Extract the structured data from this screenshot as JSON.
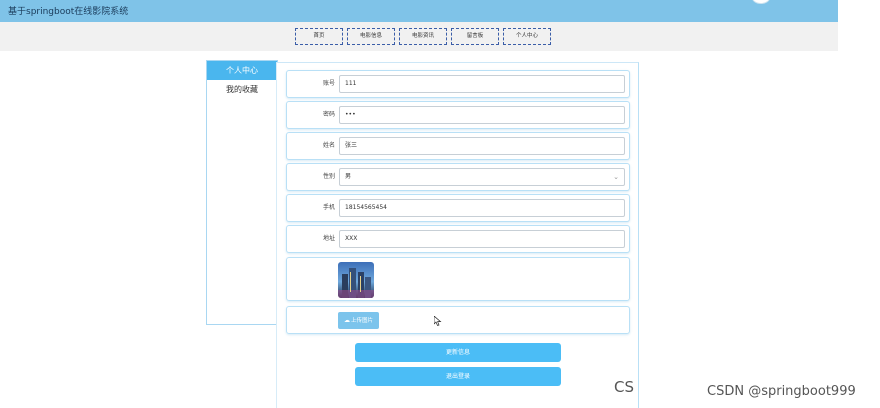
{
  "app": {
    "title": "基于springboot在线影院系统"
  },
  "nav": {
    "items": [
      "首页",
      "电影信息",
      "电影资讯",
      "留言板",
      "个人中心"
    ]
  },
  "sidebar": {
    "items": [
      "个人中心",
      "我的收藏"
    ],
    "active_index": 0
  },
  "form": {
    "account": {
      "label": "账号",
      "value": "111"
    },
    "password": {
      "label": "密码",
      "value": "•••"
    },
    "name": {
      "label": "姓名",
      "value": "张三"
    },
    "gender": {
      "label": "性别",
      "value": "男"
    },
    "phone": {
      "label": "手机",
      "value": "18154565454"
    },
    "address": {
      "label": "地址",
      "value": "XXX"
    },
    "upload_label": "上传图片"
  },
  "buttons": {
    "update": "更新信息",
    "logout": "退出登录"
  },
  "watermark": {
    "text": "CSDN @springboot999",
    "fragment": "CS"
  },
  "colors": {
    "header": "#7fc3e8",
    "accent": "#4ab6ee",
    "button": "#4bbdf6"
  }
}
